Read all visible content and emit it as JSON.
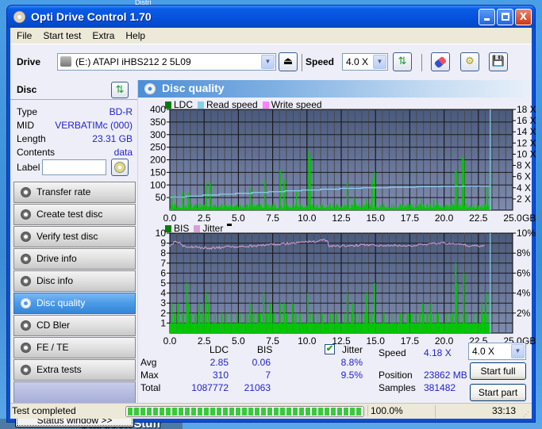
{
  "desktop": {
    "label_bottom": "Stardock Stuff",
    "label_top": "Distri"
  },
  "window": {
    "title": "Opti Drive Control 1.70",
    "controls": {
      "minimize": "_",
      "maximize": "□",
      "close": "X"
    }
  },
  "menu": [
    "File",
    "Start test",
    "Extra",
    "Help"
  ],
  "toolbar": {
    "drive_label": "Drive",
    "drive_value": "(E:)  ATAPI iHBS212  2 5L09",
    "speed_label": "Speed",
    "speed_value": "4.0 X",
    "icons": [
      "eject-icon",
      "refresh-icon",
      "erase-icon",
      "settings-icon",
      "save-icon"
    ]
  },
  "disc": {
    "header": "Disc",
    "rows": [
      {
        "key": "Type",
        "value": "BD-R"
      },
      {
        "key": "MID",
        "value": "VERBATIMc (000)"
      },
      {
        "key": "Length",
        "value": "23.31 GB"
      },
      {
        "key": "Contents",
        "value": "data"
      }
    ],
    "label_key": "Label",
    "label_value": ""
  },
  "nav": [
    {
      "label": "Transfer rate",
      "active": false
    },
    {
      "label": "Create test disc",
      "active": false
    },
    {
      "label": "Verify test disc",
      "active": false
    },
    {
      "label": "Drive info",
      "active": false
    },
    {
      "label": "Disc info",
      "active": false
    },
    {
      "label": "Disc quality",
      "active": true
    },
    {
      "label": "CD Bler",
      "active": false
    },
    {
      "label": "FE / TE",
      "active": false
    },
    {
      "label": "Extra tests",
      "active": false
    }
  ],
  "status_window_button": "Status window >>",
  "panel": {
    "title": "Disc quality"
  },
  "colors": {
    "ldc": "#008000",
    "bis": "#008000",
    "read_speed": "#87ceeb",
    "write_speed": "#ff80ff",
    "jitter": "#d8a0d8",
    "bars": "#00c800",
    "plot_top": "#4a5a7c",
    "plot_bottom": "#7f8cb0"
  },
  "chart_data": [
    {
      "type": "bar",
      "title": "LDC / Read speed",
      "legend": [
        "LDC",
        "Read speed",
        "Write speed"
      ],
      "xlabel": "GB",
      "x_ticks": [
        "0.0",
        "2.5",
        "5.0",
        "7.5",
        "10.0",
        "12.5",
        "15.0",
        "17.5",
        "20.0",
        "22.5",
        "25.0"
      ],
      "xlim": [
        0,
        25
      ],
      "ylim": [
        0,
        400
      ],
      "y_ticks": [
        "50",
        "100",
        "150",
        "200",
        "250",
        "300",
        "350",
        "400"
      ],
      "y2lim": [
        0,
        18
      ],
      "y2_ticks": [
        "2 X",
        "4 X",
        "6 X",
        "8 X",
        "10 X",
        "12 X",
        "14 X",
        "16 X",
        "18 X"
      ],
      "grid": true,
      "disc_end_gb": 23.31,
      "ldc_spikes": [
        {
          "x": 0.1,
          "y": 60
        },
        {
          "x": 0.9,
          "y": 75
        },
        {
          "x": 1.3,
          "y": 70
        },
        {
          "x": 2.6,
          "y": 105
        },
        {
          "x": 2.9,
          "y": 110
        },
        {
          "x": 5.8,
          "y": 90
        },
        {
          "x": 6.9,
          "y": 120
        },
        {
          "x": 8.0,
          "y": 160
        },
        {
          "x": 8.3,
          "y": 120
        },
        {
          "x": 9.2,
          "y": 75
        },
        {
          "x": 10.1,
          "y": 235
        },
        {
          "x": 10.2,
          "y": 210
        },
        {
          "x": 12.9,
          "y": 115
        },
        {
          "x": 13.4,
          "y": 50
        },
        {
          "x": 14.3,
          "y": 45
        },
        {
          "x": 14.7,
          "y": 120
        },
        {
          "x": 14.9,
          "y": 150
        },
        {
          "x": 18.3,
          "y": 45
        },
        {
          "x": 19.2,
          "y": 40
        },
        {
          "x": 20.8,
          "y": 160
        },
        {
          "x": 20.9,
          "y": 150
        },
        {
          "x": 21.3,
          "y": 210
        },
        {
          "x": 21.4,
          "y": 200
        },
        {
          "x": 23.1,
          "y": 90
        },
        {
          "x": 23.3,
          "y": 150
        }
      ],
      "ldc_baseline": 15,
      "read_speed": [
        {
          "x": 0.0,
          "y": 2.3
        },
        {
          "x": 1.2,
          "y": 2.5
        },
        {
          "x": 2.4,
          "y": 2.7
        },
        {
          "x": 3.6,
          "y": 2.85
        },
        {
          "x": 4.8,
          "y": 3.0
        },
        {
          "x": 6.0,
          "y": 3.15
        },
        {
          "x": 7.2,
          "y": 3.3
        },
        {
          "x": 8.4,
          "y": 3.45
        },
        {
          "x": 9.6,
          "y": 3.6
        },
        {
          "x": 11.0,
          "y": 3.75
        },
        {
          "x": 12.4,
          "y": 3.9
        },
        {
          "x": 14.0,
          "y": 4.0
        },
        {
          "x": 16.0,
          "y": 4.1
        },
        {
          "x": 18.0,
          "y": 4.2
        },
        {
          "x": 19.8,
          "y": 4.25
        },
        {
          "x": 21.4,
          "y": 4.3
        },
        {
          "x": 23.3,
          "y": 4.35
        }
      ]
    },
    {
      "type": "bar",
      "title": "BIS / Jitter",
      "legend": [
        "BIS",
        "Jitter"
      ],
      "xlabel": "GB",
      "x_ticks": [
        "0.0",
        "2.5",
        "5.0",
        "7.5",
        "10.0",
        "12.5",
        "15.0",
        "17.5",
        "20.0",
        "22.5",
        "25.0"
      ],
      "xlim": [
        0,
        25
      ],
      "ylim": [
        0,
        10
      ],
      "y_ticks": [
        "1",
        "2",
        "3",
        "4",
        "5",
        "6",
        "7",
        "8",
        "9",
        "10"
      ],
      "y2lim": [
        0,
        10
      ],
      "y2_ticks": [
        "2%",
        "4%",
        "6%",
        "8%",
        "10%"
      ],
      "grid": true,
      "disc_end_gb": 23.31,
      "bis_spikes": [
        {
          "x": 0.1,
          "y": 3
        },
        {
          "x": 0.6,
          "y": 3
        },
        {
          "x": 1.2,
          "y": 5
        },
        {
          "x": 1.3,
          "y": 3
        },
        {
          "x": 2.1,
          "y": 3
        },
        {
          "x": 2.4,
          "y": 3
        },
        {
          "x": 2.6,
          "y": 4
        },
        {
          "x": 2.8,
          "y": 3
        },
        {
          "x": 5.8,
          "y": 3
        },
        {
          "x": 6.8,
          "y": 4
        },
        {
          "x": 7.3,
          "y": 3
        },
        {
          "x": 8.0,
          "y": 3
        },
        {
          "x": 8.3,
          "y": 3
        },
        {
          "x": 8.9,
          "y": 3
        },
        {
          "x": 10.0,
          "y": 4
        },
        {
          "x": 12.9,
          "y": 4
        },
        {
          "x": 13.3,
          "y": 3
        },
        {
          "x": 14.3,
          "y": 4
        },
        {
          "x": 14.9,
          "y": 5
        },
        {
          "x": 18.4,
          "y": 3
        },
        {
          "x": 19.0,
          "y": 3
        },
        {
          "x": 20.8,
          "y": 7
        },
        {
          "x": 20.9,
          "y": 5
        },
        {
          "x": 21.4,
          "y": 6
        },
        {
          "x": 22.7,
          "y": 3
        },
        {
          "x": 23.0,
          "y": 4
        },
        {
          "x": 23.3,
          "y": 4
        }
      ],
      "bis_baseline": 1,
      "jitter": [
        {
          "x": 0.0,
          "y": 8.8
        },
        {
          "x": 0.5,
          "y": 9.2
        },
        {
          "x": 1.0,
          "y": 8.7
        },
        {
          "x": 2.0,
          "y": 8.6
        },
        {
          "x": 3.0,
          "y": 8.5
        },
        {
          "x": 4.0,
          "y": 8.6
        },
        {
          "x": 5.0,
          "y": 8.6
        },
        {
          "x": 6.0,
          "y": 8.7
        },
        {
          "x": 7.0,
          "y": 8.8
        },
        {
          "x": 8.0,
          "y": 8.9
        },
        {
          "x": 9.0,
          "y": 9.0
        },
        {
          "x": 10.0,
          "y": 9.1
        },
        {
          "x": 11.5,
          "y": 9.3
        },
        {
          "x": 11.6,
          "y": 8.7
        },
        {
          "x": 13.0,
          "y": 8.7
        },
        {
          "x": 14.0,
          "y": 8.8
        },
        {
          "x": 15.0,
          "y": 8.8
        },
        {
          "x": 16.0,
          "y": 8.8
        },
        {
          "x": 17.0,
          "y": 8.7
        },
        {
          "x": 18.0,
          "y": 8.8
        },
        {
          "x": 19.0,
          "y": 8.9
        },
        {
          "x": 20.0,
          "y": 9.0
        },
        {
          "x": 21.0,
          "y": 8.9
        },
        {
          "x": 22.0,
          "y": 8.7
        },
        {
          "x": 23.0,
          "y": 8.7
        }
      ]
    }
  ],
  "stats": {
    "headers": {
      "ldc": "LDC",
      "bis": "BIS",
      "jitter": "Jitter"
    },
    "jitter_checked": true,
    "rows": [
      {
        "label": "Avg",
        "ldc": "2.85",
        "bis": "0.06",
        "jitter": "8.8%"
      },
      {
        "label": "Max",
        "ldc": "310",
        "bis": "7",
        "jitter": "9.5%"
      },
      {
        "label": "Total",
        "ldc": "1087772",
        "bis": "21063",
        "jitter": ""
      }
    ],
    "speed_label": "Speed",
    "speed_value": "4.18 X",
    "position_label": "Position",
    "position_value": "23862 MB",
    "samples_label": "Samples",
    "samples_value": "381482",
    "speed_select": "4.0 X",
    "start_full": "Start full",
    "start_part": "Start part"
  },
  "statusbar": {
    "text": "Test completed",
    "progress_percent": 100.0,
    "progress_label": "100.0%",
    "elapsed": "33:13"
  }
}
